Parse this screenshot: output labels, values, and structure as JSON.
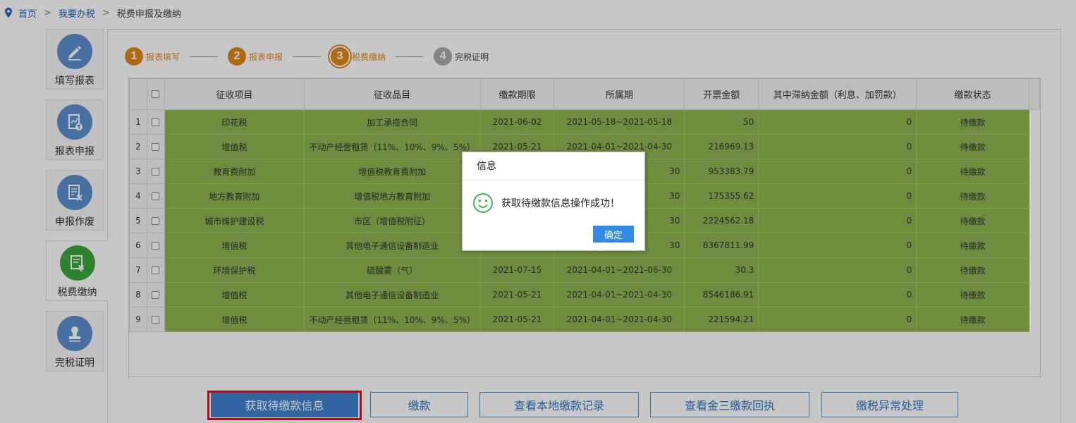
{
  "breadcrumb": {
    "home": "首页",
    "sep1": ">",
    "level2": "我要办税",
    "sep2": ">",
    "current": "税费申报及缴纳"
  },
  "sidebar": {
    "items": [
      {
        "label": "填写报表",
        "icon": "pen-icon"
      },
      {
        "label": "报表申报",
        "icon": "report-upload-icon"
      },
      {
        "label": "申报作废",
        "icon": "void-report-icon"
      },
      {
        "label": "税费缴纳",
        "icon": "tax-payment-icon",
        "active": true
      },
      {
        "label": "完税证明",
        "icon": "stamp-icon"
      }
    ]
  },
  "steps": [
    {
      "num": "1",
      "label": "报表填写",
      "state": "done"
    },
    {
      "num": "2",
      "label": "报表申报",
      "state": "done"
    },
    {
      "num": "3",
      "label": "税费缴纳",
      "state": "current"
    },
    {
      "num": "4",
      "label": "完税证明",
      "state": "todo"
    }
  ],
  "table": {
    "headers": [
      "征收项目",
      "征收品目",
      "缴款期限",
      "所属期",
      "开票金额",
      "其中滞纳金额（利息、加罚款）",
      "缴款状态"
    ],
    "rows": [
      {
        "no": "1",
        "item": "印花税",
        "category": "加工承揽合同",
        "deadline": "2021-06-02",
        "period": "2021-05-18~2021-05-18",
        "amount": "50",
        "late_fee": "0",
        "status": "待缴款"
      },
      {
        "no": "2",
        "item": "增值税",
        "category": "不动产经营租赁（11%、10%、9%、5%）",
        "deadline": "2021-05-21",
        "period": "2021-04-01~2021-04-30",
        "amount": "216969.13",
        "late_fee": "0",
        "status": "待缴款"
      },
      {
        "no": "3",
        "item": "教育费附加",
        "category": "增值税教育费附加",
        "deadline": "",
        "period": "30",
        "amount": "953383.79",
        "late_fee": "0",
        "status": "待缴款"
      },
      {
        "no": "4",
        "item": "地方教育附加",
        "category": "增值税地方教育附加",
        "deadline": "",
        "period": "30",
        "amount": "175355.62",
        "late_fee": "0",
        "status": "待缴款"
      },
      {
        "no": "5",
        "item": "城市维护建设税",
        "category": "市区（增值税附征）",
        "deadline": "",
        "period": "30",
        "amount": "2224562.18",
        "late_fee": "0",
        "status": "待缴款"
      },
      {
        "no": "6",
        "item": "增值税",
        "category": "其他电子通信设备制造业",
        "deadline": "",
        "period": "30",
        "amount": "8367811.99",
        "late_fee": "0",
        "status": "待缴款"
      },
      {
        "no": "7",
        "item": "环境保护税",
        "category": "硫酸雾（气）",
        "deadline": "2021-07-15",
        "period": "2021-04-01~2021-06-30",
        "amount": "30.3",
        "late_fee": "0",
        "status": "待缴款"
      },
      {
        "no": "8",
        "item": "增值税",
        "category": "其他电子通信设备制造业",
        "deadline": "2021-05-21",
        "period": "2021-04-01~2021-04-30",
        "amount": "8546186.91",
        "late_fee": "0",
        "status": "待缴款"
      },
      {
        "no": "9",
        "item": "增值税",
        "category": "不动产经营租赁（11%、10%、9%、5%）",
        "deadline": "2021-05-21",
        "period": "2021-04-01~2021-04-30",
        "amount": "221594.21",
        "late_fee": "0",
        "status": "待缴款"
      }
    ]
  },
  "buttons": {
    "fetch": "获取待缴款信息",
    "pay": "缴款",
    "local_records": "查看本地缴款记录",
    "jinsan_receipt": "查看金三缴款回执",
    "exception": "缴税异常处理"
  },
  "dialog": {
    "title": "信息",
    "message": "获取待缴款信息操作成功！",
    "ok": "确定"
  },
  "colors": {
    "accent": "#3d82cf",
    "row_green": "#8db550",
    "step_orange": "#e1891a",
    "highlight_red": "#e01010"
  }
}
